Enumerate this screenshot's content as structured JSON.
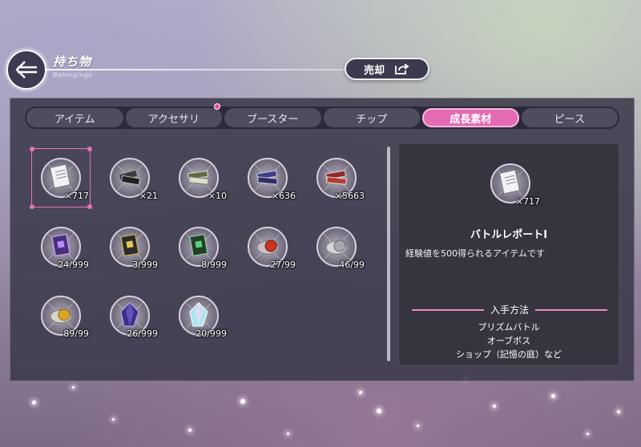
{
  "header": {
    "title": "持ち物",
    "subtitle": "Belongings",
    "sell_label": "売却"
  },
  "tabs": [
    {
      "label": "アイテム",
      "active": false,
      "badge": false
    },
    {
      "label": "アクセサリ",
      "active": false,
      "badge": true
    },
    {
      "label": "ブースター",
      "active": false,
      "badge": false
    },
    {
      "label": "チップ",
      "active": false,
      "badge": false
    },
    {
      "label": "成長素材",
      "active": true,
      "badge": false
    },
    {
      "label": "ピース",
      "active": false,
      "badge": false
    }
  ],
  "items": [
    {
      "icon": "battle-report-icon",
      "count": "×717",
      "selected": true
    },
    {
      "icon": "black-books-icon",
      "count": "×21"
    },
    {
      "icon": "green-books-icon",
      "count": "×10"
    },
    {
      "icon": "blue-books-icon",
      "count": "×636"
    },
    {
      "icon": "red-books-icon",
      "count": "×5663"
    },
    {
      "icon": "purple-tome-icon",
      "count": "24/999"
    },
    {
      "icon": "gold-tome-icon",
      "count": "3/999"
    },
    {
      "icon": "green-tome-icon",
      "count": "8/999"
    },
    {
      "icon": "red-capsule-icon",
      "count": "27/99"
    },
    {
      "icon": "silver-capsule-icon",
      "count": "46/99"
    },
    {
      "icon": "gold-capsule-icon",
      "count": "89/99"
    },
    {
      "icon": "purple-crystal-icon",
      "count": "26/999"
    },
    {
      "icon": "rainbow-crystal-icon",
      "count": "20/999"
    }
  ],
  "detail": {
    "count": "×717",
    "name": "バトルレポートⅠ",
    "description": "経験値を500得られるアイテムです",
    "source_heading": "入手方法",
    "sources": [
      "プリズムバトル",
      "オーブボス",
      "ショップ（記憶の庭）など"
    ]
  },
  "colors": {
    "accent": "#e26bb2",
    "panel": "#3e3c4e",
    "tab_inactive": "#4f4c5d"
  }
}
